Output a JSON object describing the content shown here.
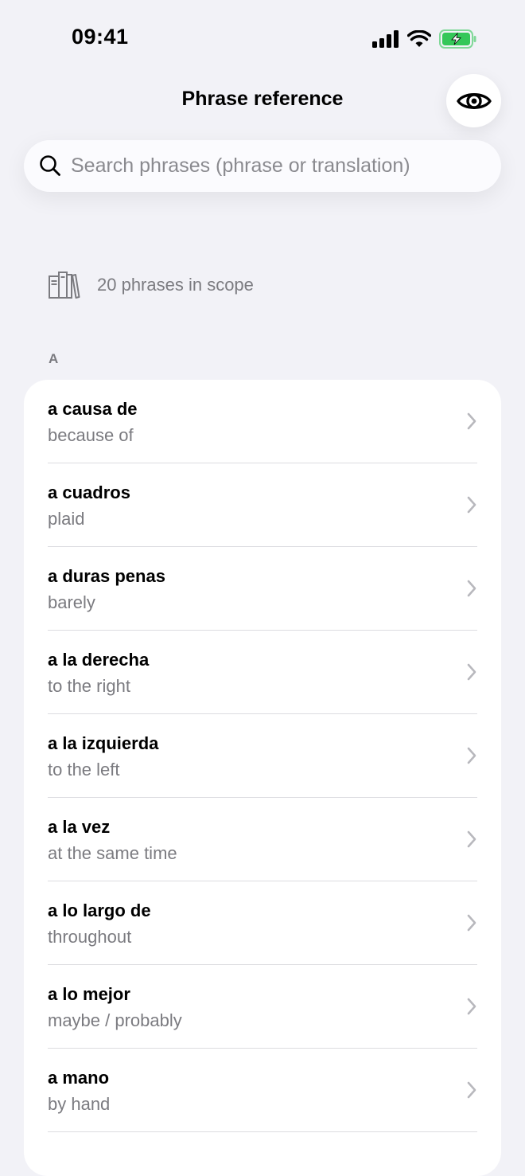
{
  "status_bar": {
    "time": "09:41"
  },
  "header": {
    "title": "Phrase reference"
  },
  "search": {
    "placeholder": "Search phrases (phrase or translation)",
    "value": ""
  },
  "scope": {
    "text": "20 phrases in scope"
  },
  "section": {
    "letter": "A"
  },
  "items": [
    {
      "phrase": "a causa de",
      "translation": "because of"
    },
    {
      "phrase": "a cuadros",
      "translation": "plaid"
    },
    {
      "phrase": "a duras penas",
      "translation": "barely"
    },
    {
      "phrase": "a la derecha",
      "translation": "to the right"
    },
    {
      "phrase": "a la izquierda",
      "translation": "to the left"
    },
    {
      "phrase": "a la vez",
      "translation": "at the same time"
    },
    {
      "phrase": "a lo largo de",
      "translation": "throughout"
    },
    {
      "phrase": "a lo mejor",
      "translation": "maybe / probably"
    },
    {
      "phrase": "a mano",
      "translation": "by hand"
    }
  ],
  "colors": {
    "background": "#f2f2f7",
    "secondary_text": "#7b7b80",
    "battery": "#34c759"
  },
  "icons": {
    "eye": "eye-icon",
    "search": "search-icon",
    "scope": "books-icon",
    "row": "chevron-right-icon"
  }
}
